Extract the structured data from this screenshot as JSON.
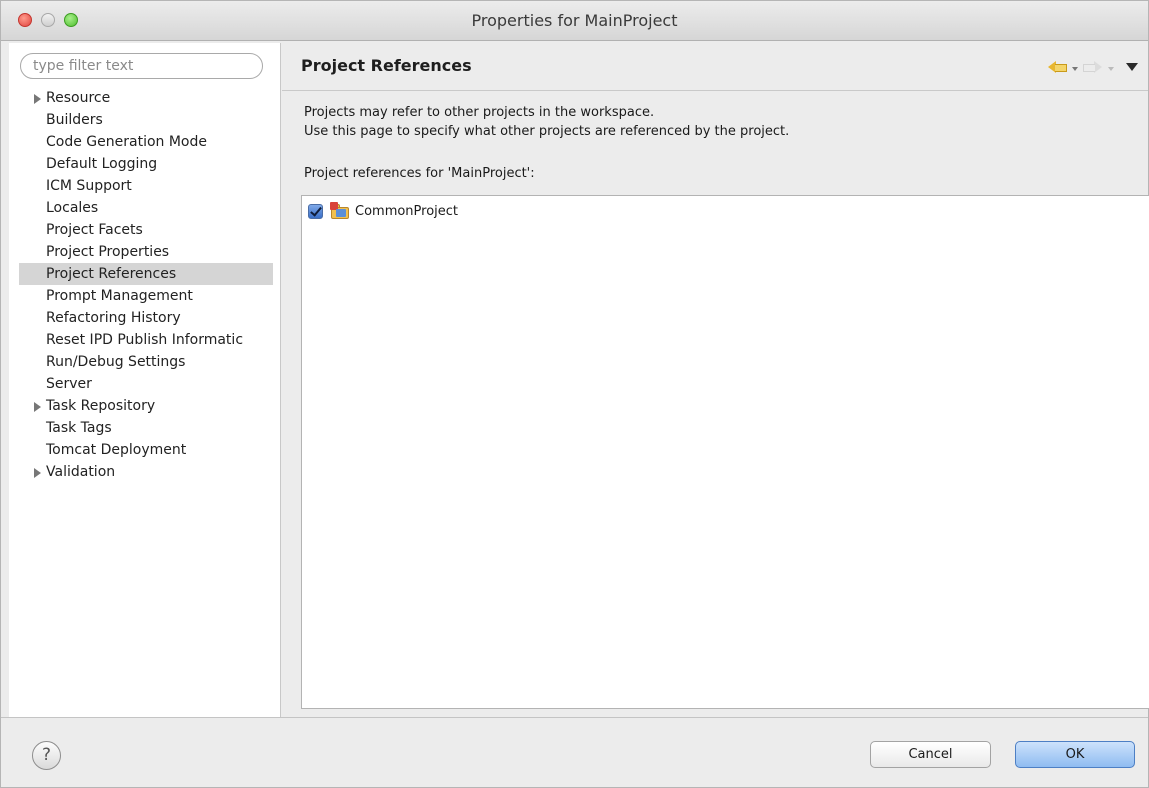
{
  "window": {
    "title": "Properties for MainProject"
  },
  "sidebar": {
    "filter_placeholder": "type filter text",
    "items": [
      {
        "label": "Resource",
        "expandable": true,
        "selected": false
      },
      {
        "label": "Builders",
        "expandable": false,
        "selected": false
      },
      {
        "label": "Code Generation Mode",
        "expandable": false,
        "selected": false
      },
      {
        "label": "Default Logging",
        "expandable": false,
        "selected": false
      },
      {
        "label": "ICM Support",
        "expandable": false,
        "selected": false
      },
      {
        "label": "Locales",
        "expandable": false,
        "selected": false
      },
      {
        "label": "Project Facets",
        "expandable": false,
        "selected": false
      },
      {
        "label": "Project Properties",
        "expandable": false,
        "selected": false
      },
      {
        "label": "Project References",
        "expandable": false,
        "selected": true
      },
      {
        "label": "Prompt Management",
        "expandable": false,
        "selected": false
      },
      {
        "label": "Refactoring History",
        "expandable": false,
        "selected": false
      },
      {
        "label": "Reset IPD Publish Informatic",
        "expandable": false,
        "selected": false
      },
      {
        "label": "Run/Debug Settings",
        "expandable": false,
        "selected": false
      },
      {
        "label": "Server",
        "expandable": false,
        "selected": false
      },
      {
        "label": "Task Repository",
        "expandable": true,
        "selected": false
      },
      {
        "label": "Task Tags",
        "expandable": false,
        "selected": false
      },
      {
        "label": "Tomcat Deployment",
        "expandable": false,
        "selected": false
      },
      {
        "label": "Validation",
        "expandable": true,
        "selected": false
      }
    ]
  },
  "main": {
    "title": "Project References",
    "description_line1": "Projects may refer to other projects in the workspace.",
    "description_line2": "Use this page to specify what other projects are referenced by the project.",
    "references_label": "Project references for 'MainProject':",
    "references": [
      {
        "label": "CommonProject",
        "checked": true,
        "icon": "project-folder-icon"
      }
    ],
    "nav_icons": [
      "back-arrow-icon",
      "forward-arrow-icon",
      "view-menu-icon"
    ]
  },
  "buttons": {
    "help_label": "?",
    "cancel_label": "Cancel",
    "ok_label": "OK"
  },
  "colors": {
    "selection": "#d5d5d5",
    "ok_button": "#8fbcf1",
    "close_button": "#e0443e",
    "max_button": "#4fbe2e"
  }
}
